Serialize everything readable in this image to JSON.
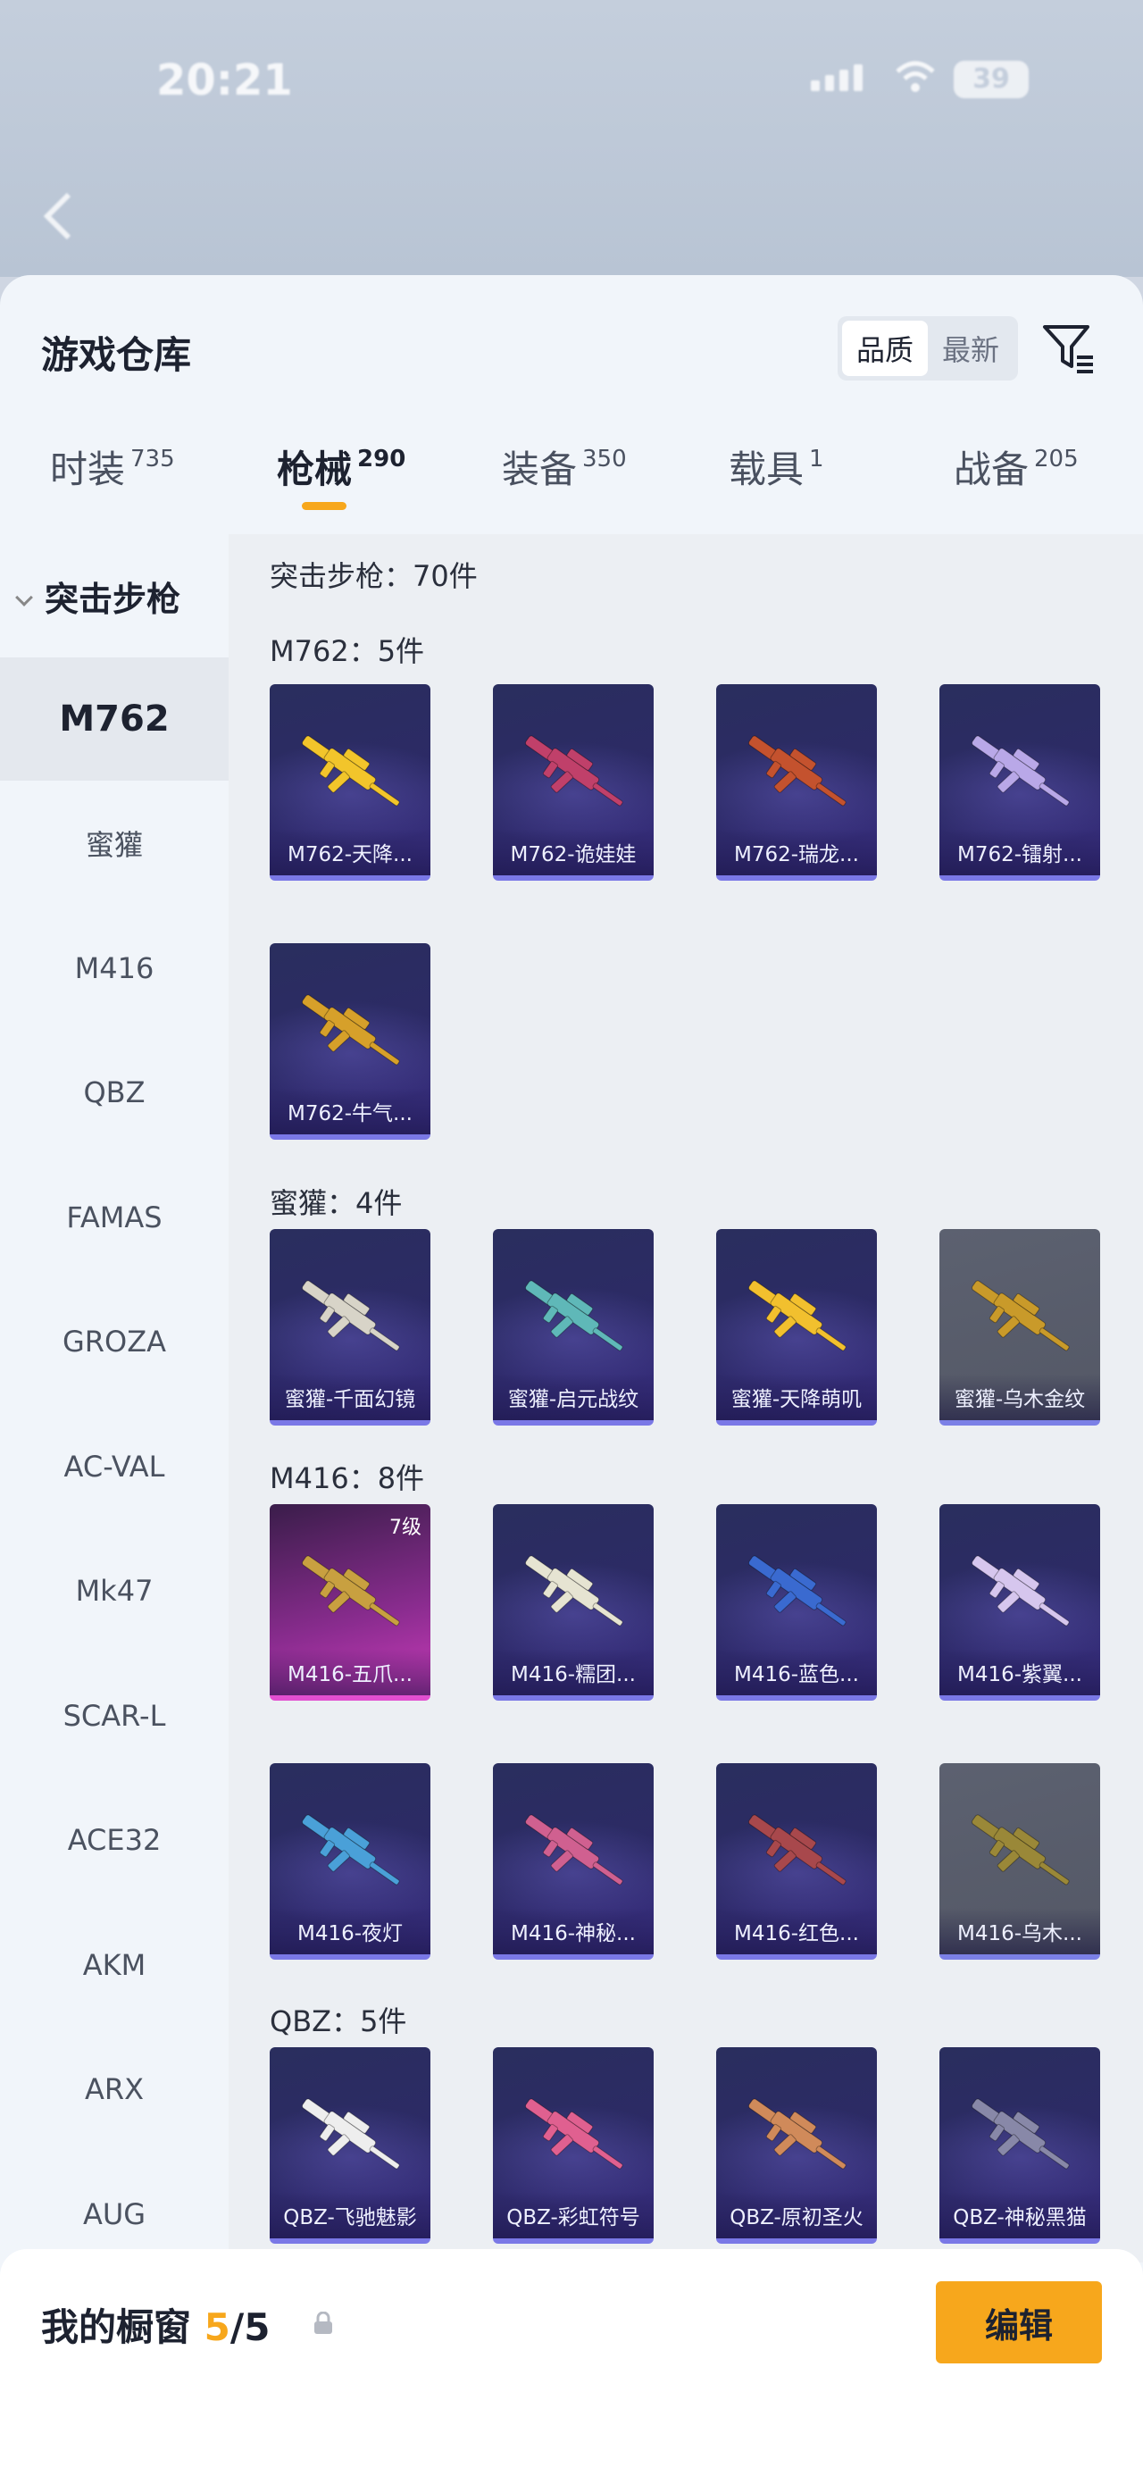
{
  "status": {
    "time": "20:21",
    "battery": "39"
  },
  "header": {
    "title": "游戏仓库",
    "sort_quality": "品质",
    "sort_latest": "最新"
  },
  "tabs": [
    {
      "label": "时装",
      "count": "735"
    },
    {
      "label": "枪械",
      "count": "290"
    },
    {
      "label": "装备",
      "count": "350"
    },
    {
      "label": "载具",
      "count": "1"
    },
    {
      "label": "战备",
      "count": "205"
    }
  ],
  "sidebar": {
    "category": "突击步枪",
    "items": [
      "M762",
      "蜜獾",
      "M416",
      "QBZ",
      "FAMAS",
      "GROZA",
      "AC-VAL",
      "Mk47",
      "SCAR-L",
      "ACE32",
      "AKM",
      "ARX",
      "AUG"
    ]
  },
  "content": {
    "category_header": "突击步枪：70件",
    "groups": [
      {
        "header": "M762：5件",
        "items": [
          "M762-天降...",
          "M762-诡娃娃",
          "M762-瑞龙...",
          "M762-镭射...",
          "M762-牛气..."
        ]
      },
      {
        "header": "蜜獾：4件",
        "items": [
          "蜜獾-千面幻镜",
          "蜜獾-启元战纹",
          "蜜獾-天降萌叽",
          "蜜獾-乌木金纹"
        ]
      },
      {
        "header": "M416：8件",
        "items": [
          "M416-五爪...",
          "M416-糯团...",
          "M416-蓝色...",
          "M416-紫翼...",
          "M416-夜灯",
          "M416-神秘...",
          "M416-红色...",
          "M416-乌木..."
        ],
        "level_badge": "7级"
      },
      {
        "header": "QBZ：5件",
        "items": [
          "QBZ-飞驰魅影",
          "QBZ-彩虹符号",
          "QBZ-原初圣火",
          "QBZ-神秘黑猫"
        ]
      }
    ]
  },
  "showcase": {
    "label": "我的橱窗",
    "current": "5",
    "total": "/5",
    "edit": "编辑"
  },
  "colors": {
    "accent": "#f7a71c",
    "card": "#2c2a66",
    "card_border": "#7a78e6"
  },
  "icons": [
    "filter-icon",
    "lock-icon",
    "share-icon",
    "chevron-down-icon"
  ]
}
